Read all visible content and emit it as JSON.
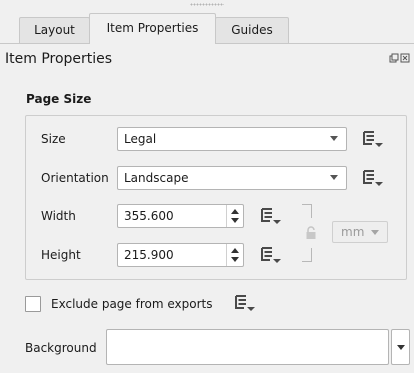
{
  "tabs": [
    {
      "label": "Layout",
      "active": false
    },
    {
      "label": "Item Properties",
      "active": true
    },
    {
      "label": "Guides",
      "active": false
    }
  ],
  "panel": {
    "title": "Item Properties",
    "dock_icons": [
      "float-icon",
      "close-icon"
    ]
  },
  "page_size": {
    "section_title": "Page Size",
    "size_label": "Size",
    "size_value": "Legal",
    "orientation_label": "Orientation",
    "orientation_value": "Landscape",
    "width_label": "Width",
    "width_value": "355.600",
    "height_label": "Height",
    "height_value": "215.900",
    "unit_value": "mm"
  },
  "exclude": {
    "label": "Exclude page from exports",
    "checked": false
  },
  "background": {
    "label": "Background",
    "value": ""
  },
  "colors": {
    "panel_bg": "#f0f0f0",
    "field_bg": "#ffffff",
    "border": "#b4b4b4",
    "icon_stroke": "#4a4a4a"
  }
}
